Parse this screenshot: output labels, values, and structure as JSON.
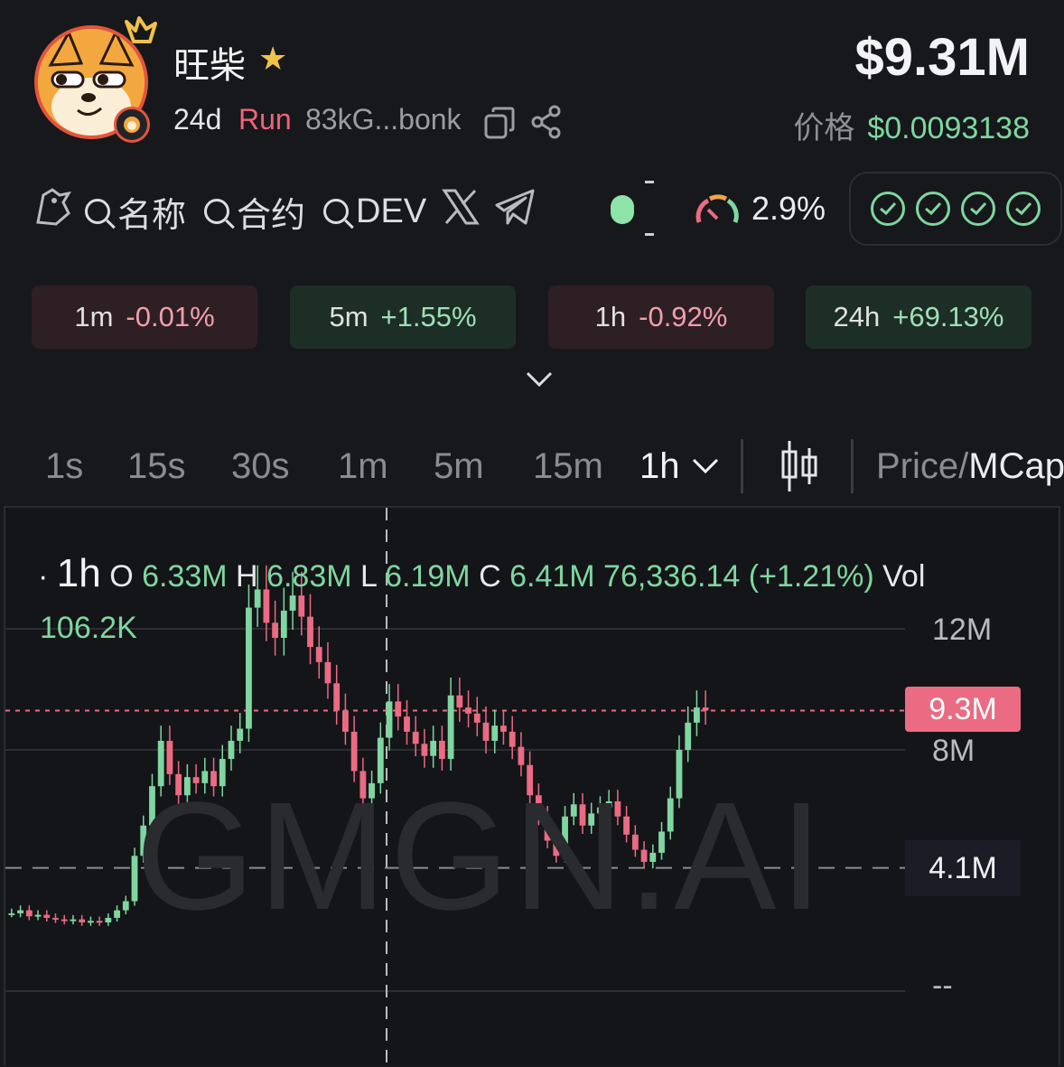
{
  "token": {
    "name": "旺柴",
    "age": "24d",
    "status": "Run",
    "address": "83kG...bonk",
    "market_cap": "$9.31M",
    "price_label": "价格",
    "price": "$0.0093138",
    "avatar_icon": "shiba-dog-avatar",
    "favorite_icon": "star-icon"
  },
  "links": {
    "search_name": "名称",
    "search_contract": "合约",
    "search_dev": "DEV",
    "holder_percent": "2.9%",
    "checks_passed": 4
  },
  "periods": [
    {
      "label": "1m",
      "value": "-0.01%",
      "trend": "negative"
    },
    {
      "label": "5m",
      "value": "+1.55%",
      "trend": "positive"
    },
    {
      "label": "1h",
      "value": "-0.92%",
      "trend": "negative"
    },
    {
      "label": "24h",
      "value": "+69.13%",
      "trend": "positive"
    }
  ],
  "intervals": [
    "1s",
    "15s",
    "30s",
    "1m",
    "5m",
    "15m"
  ],
  "active_interval": "1h",
  "chart_mode": {
    "part1": "Price/",
    "part2": "MCap"
  },
  "ohlc": {
    "interval": "1h",
    "o_label": "O",
    "o": "6.33M",
    "h_label": "H",
    "h": "6.83M",
    "l_label": "L",
    "l": "6.19M",
    "c_label": "C",
    "c": "6.41M",
    "change": "76,336.14 (+1.21%)",
    "vol_label": "Vol",
    "vol": "106.2K"
  },
  "y_axis": {
    "top": "12M",
    "mid": "8M",
    "bottom": "--"
  },
  "current_tag": "9.3M",
  "low_tag": "4.1M",
  "watermark": "GMGN.AI",
  "colors": {
    "up": "#7fd6a0",
    "down": "#ea6b82",
    "background": "#17181b"
  },
  "chart_data": {
    "type": "line",
    "y_label": "Price/MCap",
    "ylim": [
      0,
      14000000
    ],
    "current_value": 9300000,
    "low_marker": 4100000,
    "y_ticks": [
      8000000,
      12000000
    ],
    "series": [
      {
        "values": [
          2600000,
          2700000,
          2500000,
          2550000,
          2450000,
          2400000,
          2350000,
          2400000,
          2300000,
          2350000,
          2300000,
          2450000,
          2700000,
          3000000,
          4500000,
          5500000,
          6800000,
          8300000,
          7200000,
          6500000,
          7100000,
          6900000,
          7300000,
          6800000,
          7700000,
          8300000,
          8700000,
          12700000,
          13300000,
          12200000,
          11700000,
          12600000,
          13100000,
          12400000,
          11400000,
          10900000,
          10200000,
          9300000,
          8600000,
          7300000,
          6400000,
          6900000,
          8400000,
          9600000,
          9100000,
          8600000,
          8200000,
          7800000,
          8300000,
          7700000,
          9800000,
          9400000,
          9200000,
          8900000,
          8300000,
          8800000,
          8600000,
          8100000,
          7500000,
          6500000,
          5800000,
          5000000,
          4500000,
          5800000,
          6200000,
          5500000,
          5900000,
          6100000,
          6300000,
          5800000,
          5200000,
          4700000,
          4300000,
          4600000,
          5300000,
          6400000,
          8000000,
          8900000,
          9400000,
          9300000
        ]
      }
    ]
  }
}
